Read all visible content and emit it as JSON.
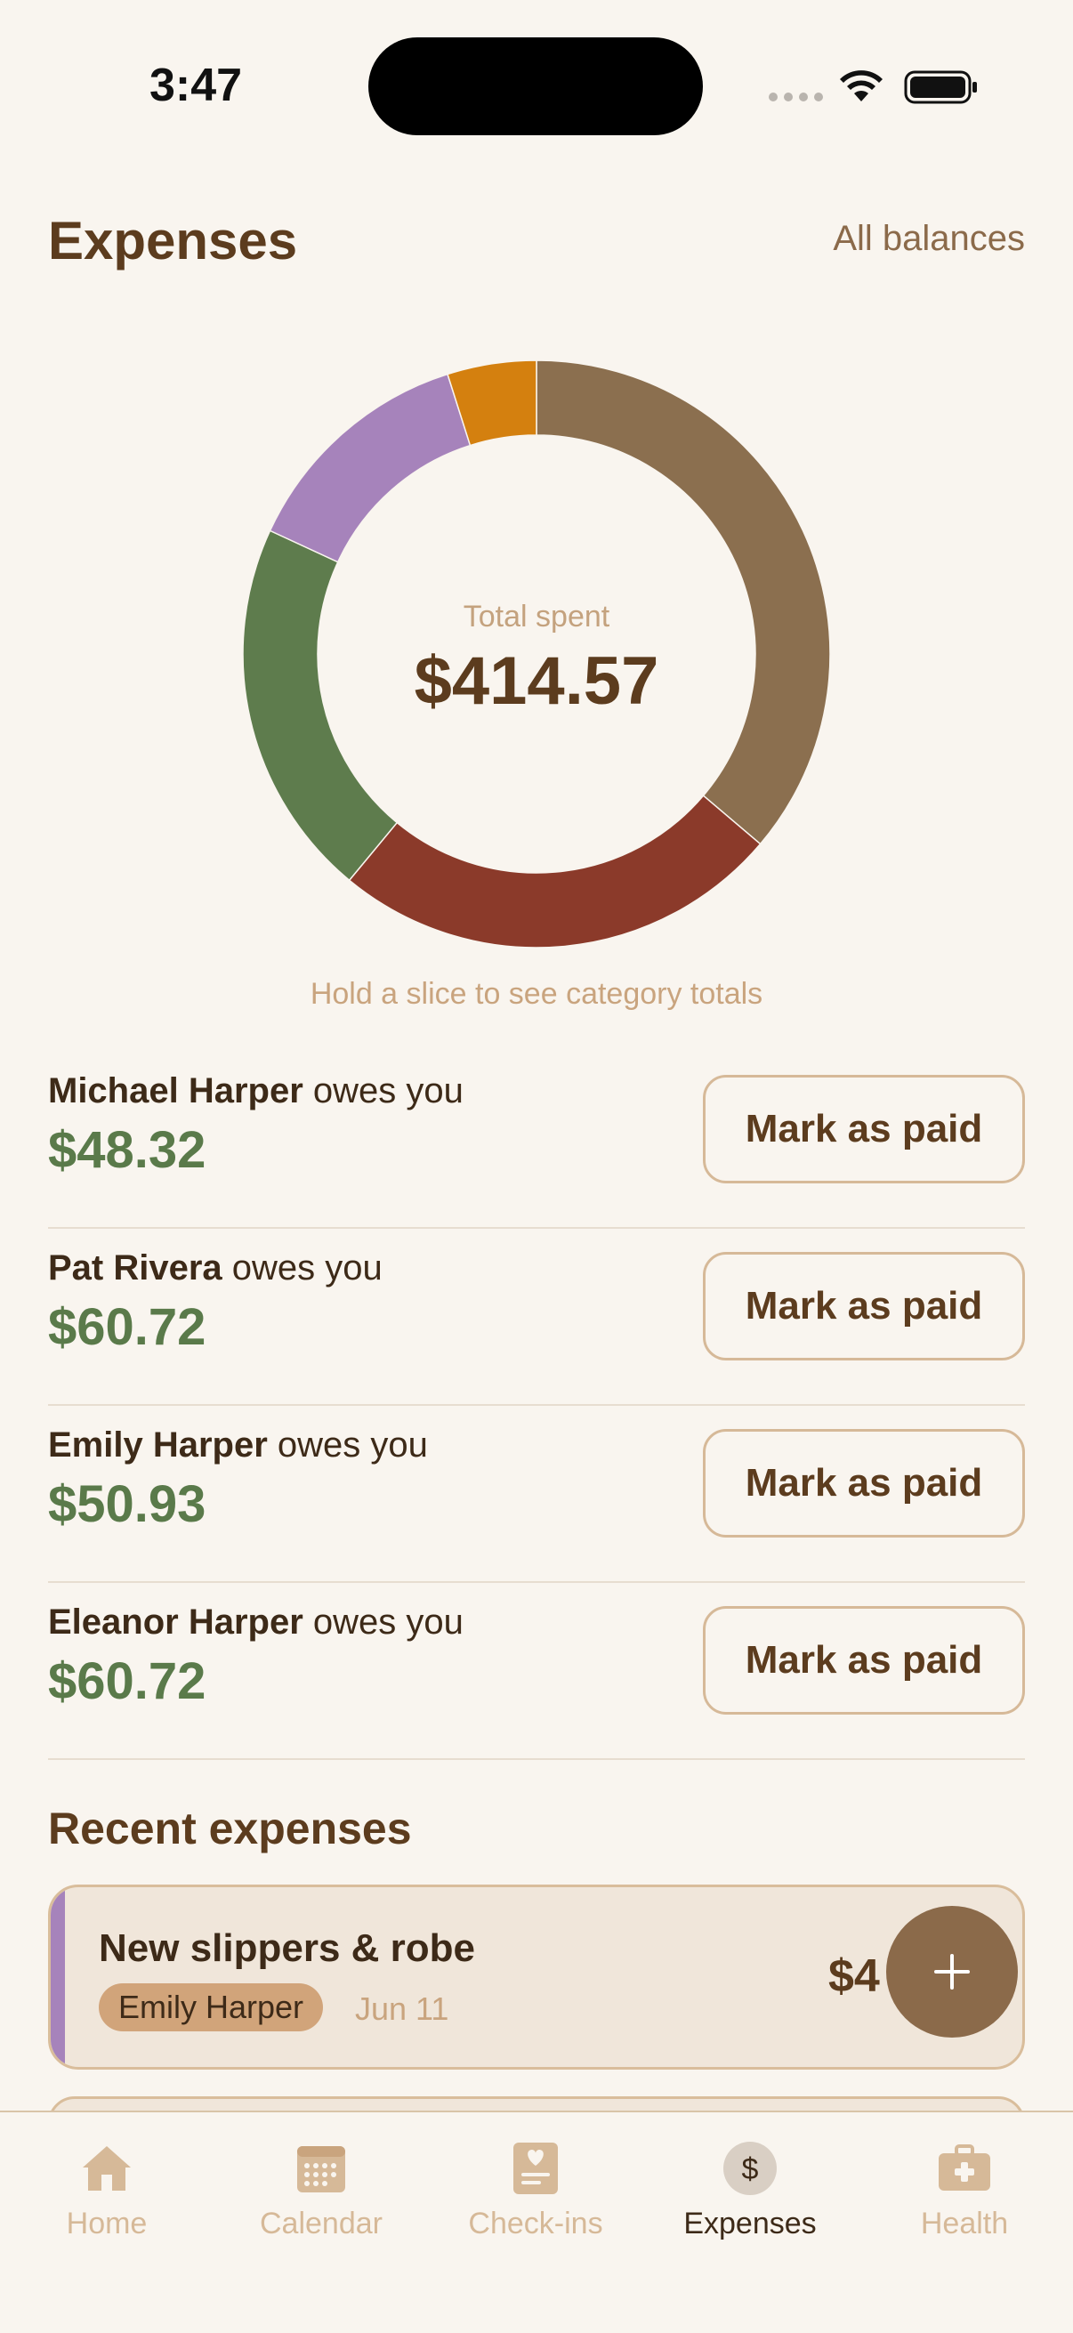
{
  "status": {
    "time": "3:47"
  },
  "header": {
    "title": "Expenses",
    "all_balances": "All balances"
  },
  "chart_data": {
    "type": "pie",
    "center_label": "Total spent",
    "center_value": "$414.57",
    "slices": [
      {
        "value": 0.362,
        "color": "#8b6f4f"
      },
      {
        "value": 0.248,
        "color": "#8b3a2a"
      },
      {
        "value": 0.209,
        "color": "#5e7c4d"
      },
      {
        "value": 0.132,
        "color": "#a683bb"
      },
      {
        "value": 0.049,
        "color": "#d4800f"
      }
    ]
  },
  "hint": "Hold a slice to see category totals",
  "balances": [
    {
      "name": "Michael Harper",
      "suffix": "owes you",
      "amount": "$48.32",
      "button": "Mark as paid"
    },
    {
      "name": "Pat Rivera",
      "suffix": "owes you",
      "amount": "$60.72",
      "button": "Mark as paid"
    },
    {
      "name": "Emily Harper",
      "suffix": "owes you",
      "amount": "$50.93",
      "button": "Mark as paid"
    },
    {
      "name": "Eleanor Harper",
      "suffix": "owes you",
      "amount": "$60.72",
      "button": "Mark as paid"
    }
  ],
  "recent": {
    "title": "Recent expenses",
    "items": [
      {
        "title": "New slippers & robe",
        "payer": "Emily Harper",
        "date": "Jun 11",
        "amount": "$4",
        "accent": "#a683bb"
      }
    ]
  },
  "tabs": [
    {
      "label": "Home",
      "icon": "home-icon"
    },
    {
      "label": "Calendar",
      "icon": "calendar-icon"
    },
    {
      "label": "Check-ins",
      "icon": "checkins-icon"
    },
    {
      "label": "Expenses",
      "icon": "dollar-icon",
      "active": true
    },
    {
      "label": "Health",
      "icon": "health-kit-icon"
    }
  ],
  "colors": {
    "accent": "#8b6a4a",
    "positive": "#5a7a4a",
    "background": "#f9f5ef"
  }
}
